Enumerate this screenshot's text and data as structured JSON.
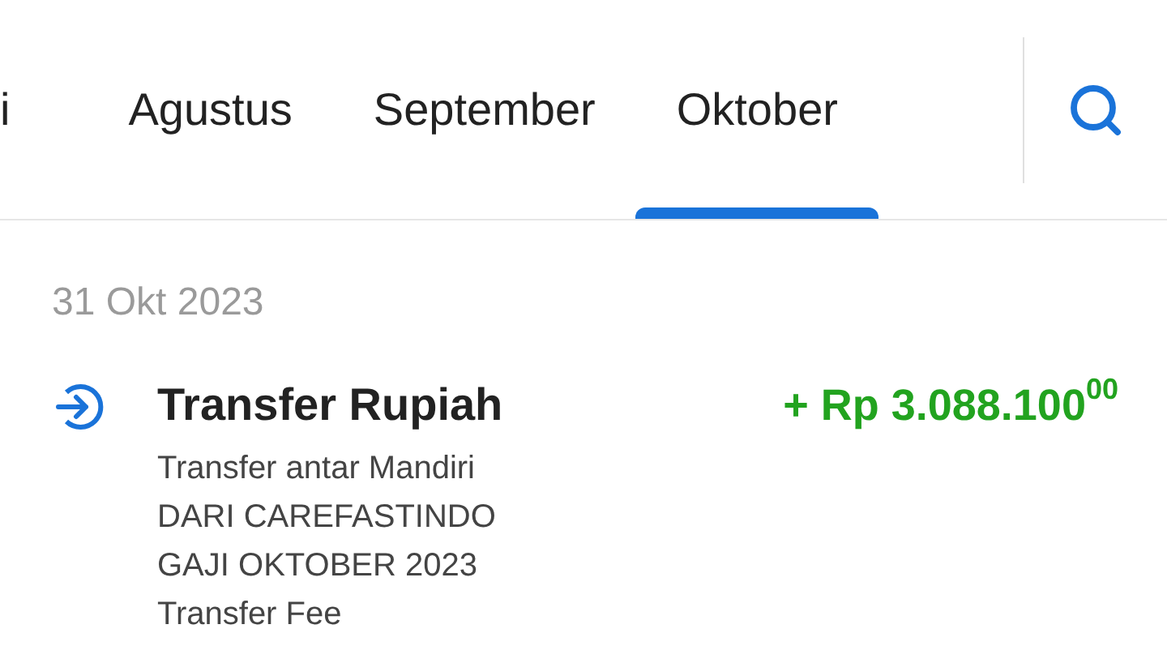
{
  "tabs": [
    {
      "label": "i",
      "selected": false
    },
    {
      "label": "Agustus",
      "selected": false
    },
    {
      "label": "September",
      "selected": false
    },
    {
      "label": "Oktober",
      "selected": true
    }
  ],
  "date": "31 Okt 2023",
  "transactions": [
    {
      "title": "Transfer Rupiah",
      "amount": "+ Rp 3.088.100$^{00}$",
      "lines": [
        "Transfer antar Mandiri",
        "DARI CAREFASTINDO",
        "GAJI OKTOBER 2023",
        "Transfer Fee"
      ]
    }
  ]
}
